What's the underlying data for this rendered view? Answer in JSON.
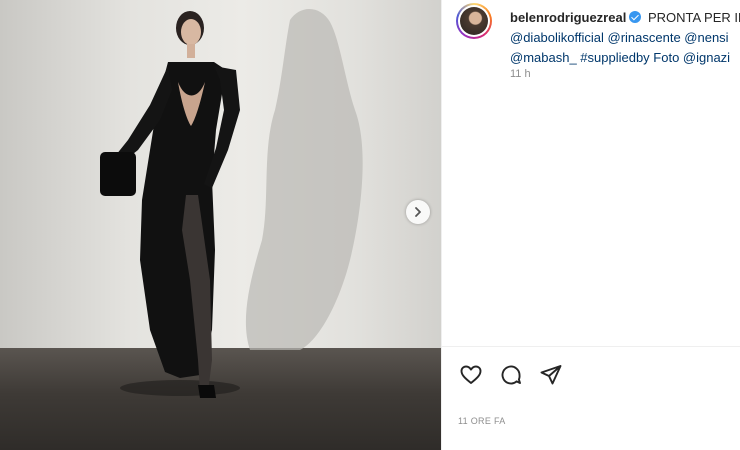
{
  "post": {
    "username": "belenrodriguezreal",
    "caption_line1": "PRONTA PER IL",
    "caption_line2": "@diabolikofficial @rinascente @nensi",
    "caption_line3": "@mabash_ #suppliedby Foto @ignazi",
    "comment_time": "11 h",
    "date_label": "11 ORE FA"
  },
  "icons": {
    "next": "chevron-right-icon",
    "like": "heart-icon",
    "comment": "comment-icon",
    "share": "send-icon",
    "verified": "verified-badge-icon"
  },
  "colors": {
    "link": "#00376b",
    "verified": "#3897f0",
    "muted": "#8e8e8e"
  }
}
